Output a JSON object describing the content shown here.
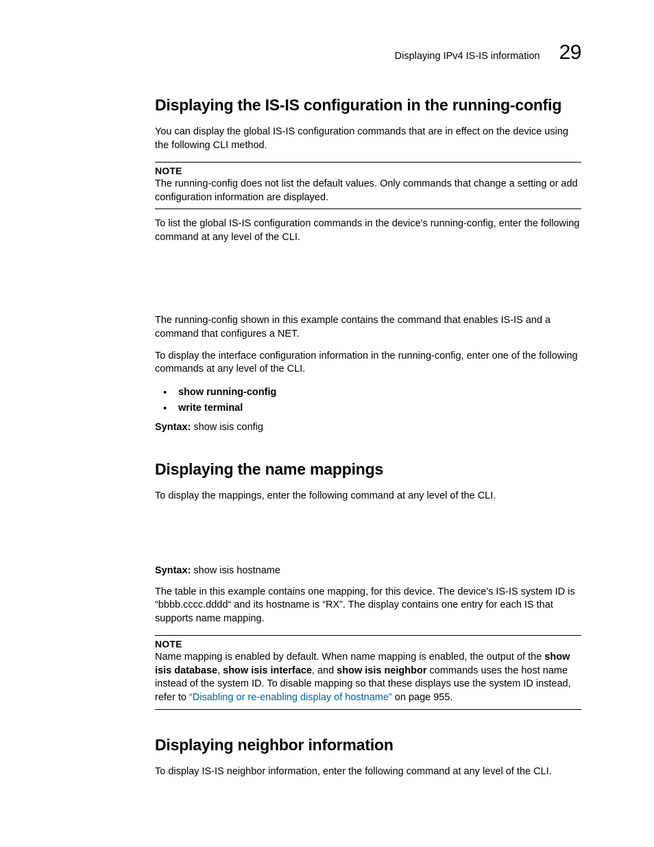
{
  "header": {
    "running_title": "Displaying IPv4 IS-IS information",
    "chapter_number": "29"
  },
  "section1": {
    "title": "Displaying the IS-IS configuration in the running-config",
    "intro": "You can display the global IS-IS configuration commands that are in effect on the device using the following CLI method.",
    "note": {
      "head": "NOTE",
      "body": "The running-config does not list the default values.  Only commands that change a setting or add configuration information are displayed."
    },
    "after_note": "To list the global IS-IS configuration commands in the device's running-config, enter the following command at any level of the CLI.",
    "after_gap": "The running-config shown in this example contains the command that enables IS-IS and a command that configures a NET.",
    "interface_p": "To display the interface configuration information in the running-config, enter one of the following commands at any level of the CLI.",
    "bullets": [
      "show running-config",
      "write terminal"
    ],
    "syntax_label": "Syntax:",
    "syntax_value": " show isis config"
  },
  "section2": {
    "title": "Displaying the name mappings",
    "intro": "To display the mappings, enter the following command at any level of the CLI.",
    "syntax_label": "Syntax:",
    "syntax_value": " show isis hostname",
    "desc": "The table in this example contains one mapping, for this device. The device's IS-IS system ID is “bbbb.cccc.dddd“ and its hostname is “RX”. The display contains one entry for each IS that supports name mapping.",
    "note": {
      "head": "NOTE",
      "pre": "Name mapping is enabled by default. When name mapping is enabled, the output of the ",
      "b1": "show isis database",
      "mid1": ", ",
      "b2": "show isis interface",
      "mid2": ", and ",
      "b3": "show isis neighbor",
      "post1": " commands uses the host name instead of the system ID. To disable mapping so that these displays use the system ID instead, refer to ",
      "link": "“Disabling or re-enabling display of hostname”",
      "post2": " on page 955."
    }
  },
  "section3": {
    "title": "Displaying neighbor information",
    "intro": "To display IS-IS neighbor information, enter the following command at any level of the CLI."
  }
}
